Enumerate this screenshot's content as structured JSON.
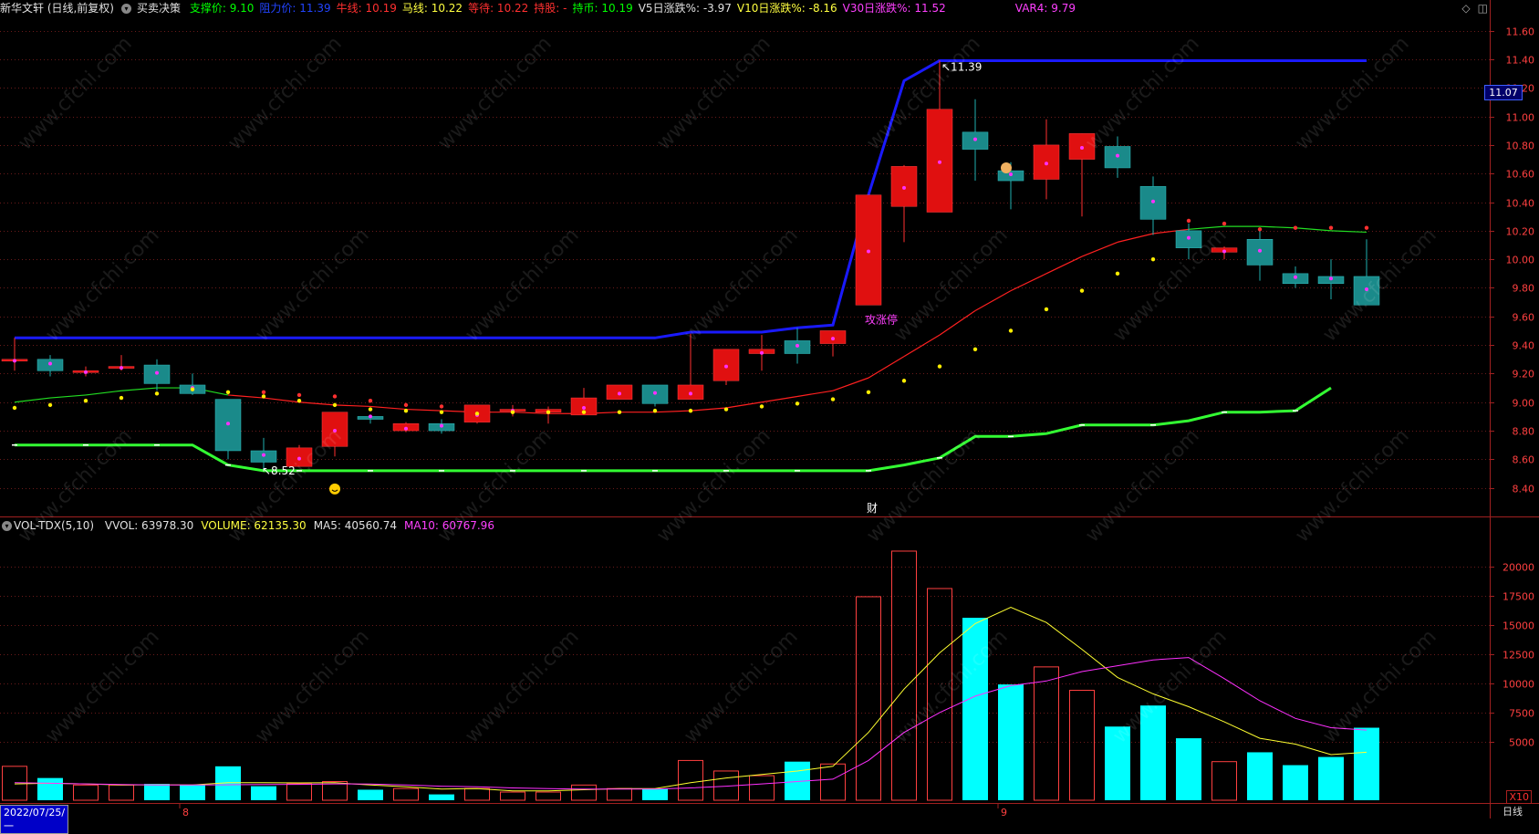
{
  "header": {
    "stock_title": "新华文轩 (日线,前复权)",
    "indicator_name": "买卖决策",
    "items": [
      {
        "label": "支撑价: 9.10",
        "color": "#00ff00"
      },
      {
        "label": "阻力价: 11.39",
        "color": "#2244ff"
      },
      {
        "label": "牛线: 10.19",
        "color": "#ff3030"
      },
      {
        "label": "马线: 10.22",
        "color": "#ffff40"
      },
      {
        "label": "等待: 10.22",
        "color": "#ff3030"
      },
      {
        "label": "持股: -",
        "color": "#ff3030"
      },
      {
        "label": "持币: 10.19",
        "color": "#00ff00"
      },
      {
        "label": "V5日涨跌%: -3.97",
        "color": "#e0e0e0"
      },
      {
        "label": "V10日涨跌%: -8.16",
        "color": "#ffff40"
      },
      {
        "label": "V30日涨跌%: 11.52",
        "color": "#ff40ff"
      },
      {
        "label": "VAR4: 9.79",
        "color": "#ff40ff"
      }
    ]
  },
  "volume_header": {
    "indicator": "VOL-TDX(5,10)",
    "items": [
      {
        "label": "VVOL: 63978.30",
        "color": "#e0e0e0"
      },
      {
        "label": "VOLUME: 62135.30",
        "color": "#ffff40"
      },
      {
        "label": "MA5: 40560.74",
        "color": "#e0e0e0"
      },
      {
        "label": "MA10: 60767.96",
        "color": "#ff40ff"
      }
    ]
  },
  "current_price_tag": "11.07",
  "date_label": "2022/07/25/一",
  "period_label": "日线",
  "x10_label": "X10",
  "watermark": "www.cfchi.com",
  "chart_data": {
    "type": "candlestick",
    "price_axis": {
      "min": 8.2,
      "max": 11.7,
      "ticks": [
        "11.60",
        "11.40",
        "11.20",
        "11.00",
        "10.80",
        "10.60",
        "10.40",
        "10.20",
        "10.00",
        "9.80",
        "9.60",
        "9.40",
        "9.20",
        "9.00",
        "8.80",
        "8.60",
        "8.40"
      ]
    },
    "volume_axis": {
      "min": 0,
      "max": 22000,
      "ticks": [
        "20000",
        "17500",
        "15000",
        "12500",
        "10000",
        "7500",
        "5000"
      ]
    },
    "x_labels": [
      {
        "index": 5,
        "text": "8"
      },
      {
        "index": 28,
        "text": "9"
      }
    ],
    "candles": [
      {
        "o": 9.3,
        "c": 9.3,
        "h": 9.45,
        "l": 9.22
      },
      {
        "o": 9.3,
        "c": 9.22,
        "h": 9.33,
        "l": 9.18
      },
      {
        "o": 9.22,
        "c": 9.22,
        "h": 9.25,
        "l": 9.18
      },
      {
        "o": 9.25,
        "c": 9.25,
        "h": 9.33,
        "l": 9.22
      },
      {
        "o": 9.26,
        "c": 9.13,
        "h": 9.3,
        "l": 9.08
      },
      {
        "o": 9.12,
        "c": 9.06,
        "h": 9.2,
        "l": 9.05
      },
      {
        "o": 9.02,
        "c": 8.66,
        "h": 9.02,
        "l": 8.6
      },
      {
        "o": 8.66,
        "c": 8.58,
        "h": 8.75,
        "l": 8.52
      },
      {
        "o": 8.55,
        "c": 8.68,
        "h": 8.7,
        "l": 8.55
      },
      {
        "o": 8.69,
        "c": 8.93,
        "h": 8.93,
        "l": 8.62
      },
      {
        "o": 8.9,
        "c": 8.88,
        "h": 8.9,
        "l": 8.85
      },
      {
        "o": 8.8,
        "c": 8.85,
        "h": 8.86,
        "l": 8.79
      },
      {
        "o": 8.85,
        "c": 8.8,
        "h": 8.88,
        "l": 8.78
      },
      {
        "o": 8.86,
        "c": 8.98,
        "h": 8.98,
        "l": 8.85
      },
      {
        "o": 8.95,
        "c": 8.95,
        "h": 8.98,
        "l": 8.9
      },
      {
        "o": 8.93,
        "c": 8.95,
        "h": 8.97,
        "l": 8.85
      },
      {
        "o": 8.91,
        "c": 9.03,
        "h": 9.1,
        "l": 8.91
      },
      {
        "o": 9.02,
        "c": 9.12,
        "h": 9.12,
        "l": 9.02
      },
      {
        "o": 9.12,
        "c": 8.99,
        "h": 9.12,
        "l": 8.97
      },
      {
        "o": 9.02,
        "c": 9.12,
        "h": 9.48,
        "l": 9.02
      },
      {
        "o": 9.15,
        "c": 9.37,
        "h": 9.37,
        "l": 9.12
      },
      {
        "o": 9.34,
        "c": 9.37,
        "h": 9.47,
        "l": 9.22
      },
      {
        "o": 9.43,
        "c": 9.34,
        "h": 9.52,
        "l": 9.27
      },
      {
        "o": 9.41,
        "c": 9.5,
        "h": 9.5,
        "l": 9.32
      },
      {
        "o": 9.68,
        "c": 10.45,
        "h": 10.45,
        "l": 9.68
      },
      {
        "o": 10.37,
        "c": 10.65,
        "h": 10.66,
        "l": 10.12
      },
      {
        "o": 10.33,
        "c": 11.05,
        "h": 11.39,
        "l": 10.33
      },
      {
        "o": 10.89,
        "c": 10.77,
        "h": 11.12,
        "l": 10.55
      },
      {
        "o": 10.62,
        "c": 10.55,
        "h": 10.68,
        "l": 10.35
      },
      {
        "o": 10.56,
        "c": 10.8,
        "h": 10.98,
        "l": 10.42
      },
      {
        "o": 10.7,
        "c": 10.88,
        "h": 10.88,
        "l": 10.3
      },
      {
        "o": 10.79,
        "c": 10.64,
        "h": 10.86,
        "l": 10.57
      },
      {
        "o": 10.51,
        "c": 10.28,
        "h": 10.58,
        "l": 10.17
      },
      {
        "o": 10.2,
        "c": 10.08,
        "h": 10.25,
        "l": 10.0
      },
      {
        "o": 10.05,
        "c": 10.08,
        "h": 10.09,
        "l": 10.0
      },
      {
        "o": 10.14,
        "c": 9.96,
        "h": 10.2,
        "l": 9.85
      },
      {
        "o": 9.9,
        "c": 9.83,
        "h": 9.95,
        "l": 9.8
      },
      {
        "o": 9.88,
        "c": 9.83,
        "h": 10.0,
        "l": 9.72
      },
      {
        "o": 9.88,
        "c": 9.68,
        "h": 10.14,
        "l": 9.68
      }
    ],
    "volume": [
      2900,
      1900,
      1300,
      1300,
      1400,
      1300,
      2900,
      1200,
      1400,
      1600,
      900,
      1000,
      500,
      1000,
      700,
      700,
      1300,
      1000,
      1000,
      3400,
      2500,
      2100,
      3300,
      3100,
      17400,
      21300,
      18100,
      15600,
      9900,
      11400,
      9400,
      6300,
      8100,
      5300,
      3300,
      4100,
      3000,
      3700,
      6200
    ],
    "resistance_line": [
      9.45,
      9.45,
      9.45,
      9.45,
      9.45,
      9.45,
      9.45,
      9.45,
      9.45,
      9.45,
      9.45,
      9.45,
      9.45,
      9.45,
      9.45,
      9.45,
      9.45,
      9.45,
      9.45,
      9.49,
      9.49,
      9.49,
      9.52,
      9.54,
      10.45,
      11.25,
      11.39,
      11.39,
      11.39,
      11.39,
      11.39,
      11.39,
      11.39,
      11.39,
      11.39,
      11.39,
      11.39,
      11.39,
      11.39
    ],
    "support_line": [
      8.7,
      8.7,
      8.7,
      8.7,
      8.7,
      8.7,
      8.56,
      8.52,
      8.52,
      8.52,
      8.52,
      8.52,
      8.52,
      8.52,
      8.52,
      8.52,
      8.52,
      8.52,
      8.52,
      8.52,
      8.52,
      8.52,
      8.52,
      8.52,
      8.52,
      8.56,
      8.61,
      8.76,
      8.76,
      8.78,
      8.84,
      8.84,
      8.84,
      8.87,
      8.93,
      8.93,
      8.94,
      9.1
    ],
    "bull_line": [
      9.0,
      9.03,
      9.05,
      9.08,
      9.1,
      9.1,
      9.05,
      9.03,
      9.0,
      8.98,
      8.97,
      8.95,
      8.94,
      8.93,
      8.93,
      8.92,
      8.92,
      8.93,
      8.93,
      8.94,
      8.96,
      9.0,
      9.04,
      9.08,
      9.17,
      9.32,
      9.47,
      9.64,
      9.78,
      9.9,
      10.02,
      10.12,
      10.18,
      10.21,
      10.23,
      10.23,
      10.22,
      10.2,
      10.19
    ],
    "dots_yellow": [
      8.96,
      8.98,
      9.01,
      9.03,
      9.06,
      9.09,
      9.07,
      9.04,
      9.01,
      8.98,
      8.95,
      8.94,
      8.93,
      8.92,
      8.93,
      8.93,
      8.93,
      8.93,
      8.94,
      8.94,
      8.95,
      8.97,
      8.99,
      9.02,
      9.07,
      9.15,
      9.25,
      9.37,
      9.5,
      9.65,
      9.78,
      9.9,
      10.0,
      null,
      null,
      null,
      null,
      null,
      null
    ],
    "dots_red": [
      null,
      null,
      null,
      null,
      null,
      null,
      null,
      9.07,
      9.05,
      9.04,
      9.01,
      8.98,
      8.97,
      null,
      null,
      null,
      null,
      null,
      null,
      null,
      null,
      null,
      null,
      null,
      null,
      null,
      null,
      null,
      null,
      null,
      null,
      null,
      null,
      10.27,
      10.25,
      10.21,
      10.22,
      10.22,
      10.22
    ],
    "vol_ma5": [
      1400,
      1450,
      1400,
      1300,
      1320,
      1300,
      1500,
      1500,
      1480,
      1500,
      1300,
      1150,
      950,
      1000,
      800,
      800,
      900,
      1000,
      1000,
      1500,
      1900,
      2200,
      2500,
      2900,
      5800,
      9500,
      12600,
      15100,
      16500,
      15200,
      12900,
      10500,
      9100,
      8000,
      6700,
      5300,
      4800,
      3900,
      4100
    ],
    "vol_ma10": [
      1500,
      1450,
      1400,
      1350,
      1300,
      1300,
      1320,
      1350,
      1360,
      1400,
      1380,
      1300,
      1200,
      1150,
      1050,
      1000,
      950,
      950,
      950,
      1050,
      1200,
      1400,
      1600,
      1800,
      3400,
      5800,
      7500,
      8900,
      9800,
      10200,
      11000,
      11500,
      12000,
      12200,
      10400,
      8500,
      7000,
      6200,
      6000
    ]
  },
  "annotations": {
    "peak_label": "11.39",
    "low_label": "8.52",
    "limit_up_label": "攻涨停",
    "cai_label": "财"
  }
}
